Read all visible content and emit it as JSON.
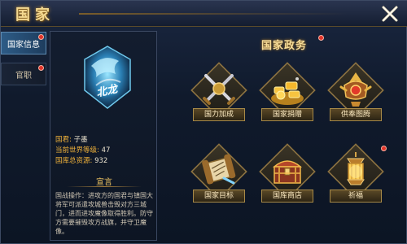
{
  "window": {
    "title": "国家"
  },
  "tabs": [
    {
      "label": "国家信息",
      "active": true
    },
    {
      "label": "官职",
      "active": false
    }
  ],
  "info": {
    "emblem_text": "北龙",
    "ruler_label": "国君:",
    "ruler_value": "子墨",
    "level_label": "当前世界等级:",
    "level_value": "47",
    "resources_label": "国库总资源:",
    "resources_value": "932",
    "declaration_title": "宣言",
    "declaration_text": "国战操作：进攻方的国君与镇国大将军可派遣攻城兽击毁对方三城门，进而进攻魔像取得胜利。防守方需要摧毁攻方战旗，并守卫魔像。"
  },
  "affairs": {
    "title": "国家政务",
    "items": [
      {
        "label": "国力加成",
        "icon": "crossed-swords-icon"
      },
      {
        "label": "国家捐赠",
        "icon": "gold-pile-icon"
      },
      {
        "label": "供奉图腾",
        "icon": "totem-icon"
      },
      {
        "label": "国家目标",
        "icon": "scroll-icon"
      },
      {
        "label": "国库商店",
        "icon": "treasure-chest-icon"
      },
      {
        "label": "祈福",
        "icon": "lantern-icon"
      }
    ]
  },
  "colors": {
    "accent_gold": "#f3d890",
    "active_tab": "#2d5b86",
    "label_orange": "#f1b23a",
    "notification_red": "#e0342a"
  }
}
